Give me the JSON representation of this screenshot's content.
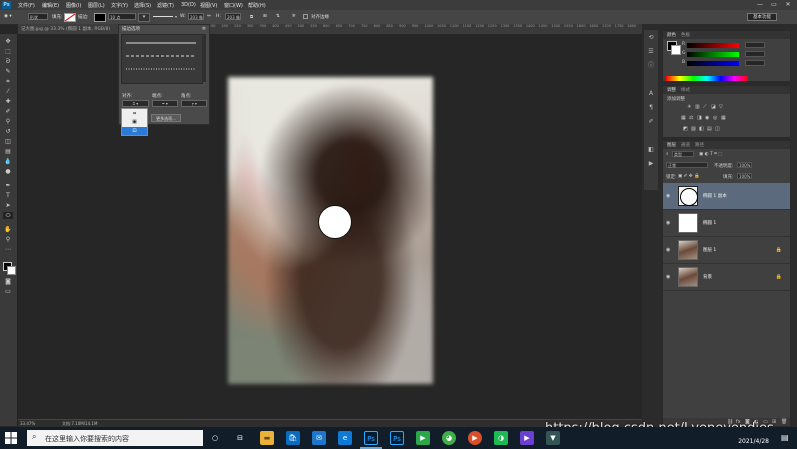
{
  "app": {
    "logo": "Ps"
  },
  "menubar": {
    "items": [
      "文件(F)",
      "编辑(E)",
      "图像(I)",
      "图层(L)",
      "文字(Y)",
      "选择(S)",
      "滤镜(T)",
      "3D(D)",
      "视图(V)",
      "窗口(W)",
      "帮助(H)"
    ],
    "window_controls": [
      "—",
      "▭",
      "✕"
    ]
  },
  "options_bar": {
    "tool_mode": "形状",
    "fill_label": "填充:",
    "stroke_label": "描边:",
    "stroke_width": "10 点",
    "w_label": "W:",
    "w_value": "203 像",
    "h_label": "H:",
    "h_value": "203 像",
    "align_edges": "对齐边缘",
    "workspace": "基本功能"
  },
  "document": {
    "tab_title": "记大图.jpg @ 33.3% (椭圆 1 副本, RGB/8)",
    "zoom": "33.47%",
    "info": "文档:7.10M/14.1M"
  },
  "ruler": {
    "ticks": [
      "200",
      "150",
      "100",
      "50",
      "0",
      "50",
      "100",
      "150",
      "200",
      "250",
      "300",
      "350",
      "400",
      "450",
      "500",
      "550",
      "600",
      "650",
      "700",
      "750",
      "800",
      "850",
      "900",
      "950",
      "1000",
      "1050",
      "1100",
      "1150",
      "1200",
      "1250",
      "1300",
      "1350",
      "1400",
      "1450",
      "1500",
      "1550",
      "1600",
      "1650",
      "1700",
      "1750",
      "1800"
    ]
  },
  "brush_panel": {
    "title": "描边选项",
    "align_label": "对齐:",
    "caps_label": "端点:",
    "corners_label": "角点:",
    "more_button": "更多选项...",
    "align_options": [
      "⌗",
      "▣",
      "⊡"
    ]
  },
  "panels": {
    "color": {
      "tabs": [
        "颜色",
        "色板"
      ],
      "channels": [
        "R",
        "G",
        "B"
      ],
      "values": [
        "",
        "",
        ""
      ]
    },
    "adjustments": {
      "tabs": [
        "调整",
        "样式"
      ],
      "title": "添加调整"
    },
    "layers": {
      "tabs": [
        "图层",
        "通道",
        "路径"
      ],
      "filter": "类型",
      "blend_mode": "正常",
      "opacity_label": "不透明度:",
      "opacity": "100%",
      "lock_label": "锁定:",
      "fill_label": "填充:",
      "fill": "100%",
      "items": [
        {
          "name": "椭圆 1 副本",
          "selected": true
        },
        {
          "name": "椭圆 1",
          "selected": false
        },
        {
          "name": "图层 1",
          "selected": false
        },
        {
          "name": "背景",
          "selected": false
        }
      ]
    }
  },
  "taskbar": {
    "search_placeholder": "在这里输入你要搜索的内容",
    "time": "",
    "date": "2021/4/28",
    "apps": [
      "○",
      "⊟",
      "▬",
      "🛍",
      "✉",
      "e",
      "Ps",
      "Ps",
      "▶",
      "◕",
      "▶",
      "◑",
      "▶",
      "▼"
    ]
  },
  "watermark": "https://blog.csdn.net/Lvenevendies",
  "colors": {
    "accent": "#0a5c91",
    "selected_layer": "#5b6a7c",
    "taskbar": "#111e2a"
  }
}
